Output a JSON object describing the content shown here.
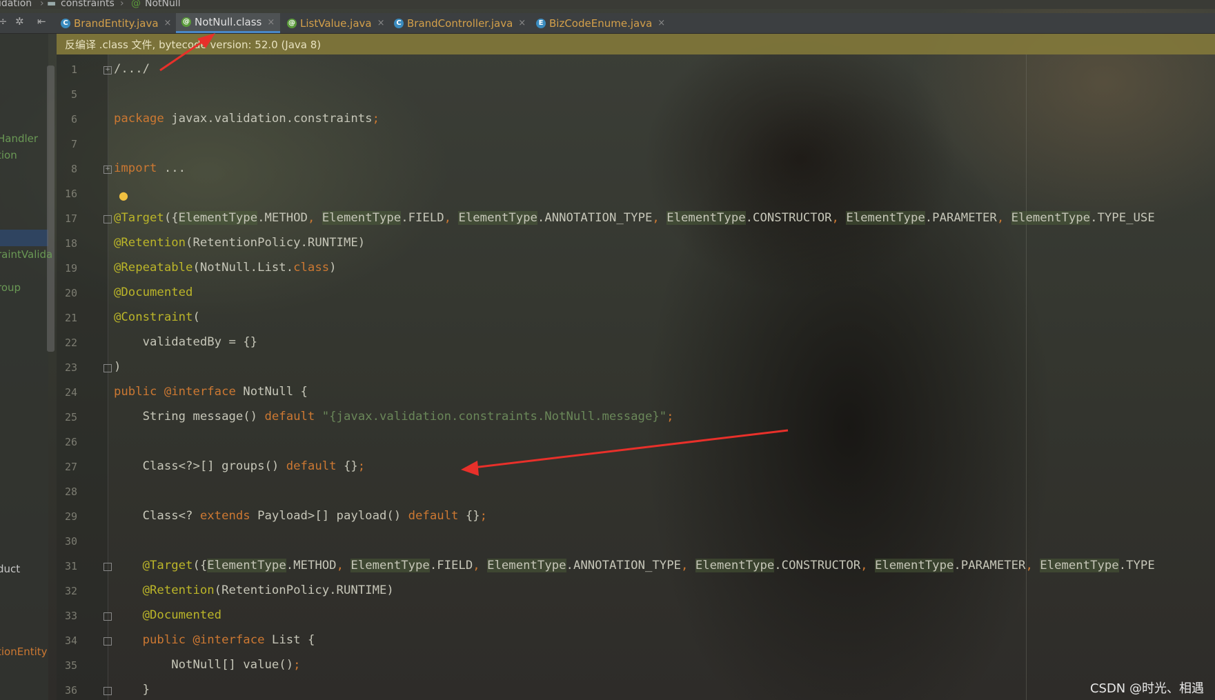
{
  "breadcrumb": [
    "idation",
    "constraints",
    "NotNull"
  ],
  "tabs": [
    {
      "label": "BrandEntity.java",
      "icon": "class-icon",
      "color": "#3a8bbf"
    },
    {
      "label": "NotNull.class",
      "icon": "annotation-icon",
      "color": "#5a9a3a",
      "active": true
    },
    {
      "label": "ListValue.java",
      "icon": "annotation-icon",
      "color": "#5a9a3a"
    },
    {
      "label": "BrandController.java",
      "icon": "class-icon",
      "color": "#3a8bbf"
    },
    {
      "label": "BizCodeEnume.java",
      "icon": "enum-icon",
      "color": "#3a8bbf"
    }
  ],
  "notice": "反编译 .class 文件, bytecode version: 52.0 (Java 8)",
  "sidebar": [
    {
      "label": "Handler"
    },
    {
      "label": "tion"
    },
    {
      "label": "raintValida"
    },
    {
      "label": "roup"
    },
    {
      "label": "duct"
    },
    {
      "label": "tionEntity"
    }
  ],
  "lines": [
    {
      "num": "1",
      "text": "/.../"
    },
    {
      "num": "5",
      "text": ""
    },
    {
      "num": "6",
      "text": "package javax.validation.constraints;"
    },
    {
      "num": "7",
      "text": ""
    },
    {
      "num": "8",
      "text": "import ..."
    },
    {
      "num": "16",
      "text": ""
    },
    {
      "num": "17",
      "text": "@Target({ElementType.METHOD, ElementType.FIELD, ElementType.ANNOTATION_TYPE, ElementType.CONSTRUCTOR, ElementType.PARAMETER, ElementType.TYPE_USE"
    },
    {
      "num": "18",
      "text": "@Retention(RetentionPolicy.RUNTIME)"
    },
    {
      "num": "19",
      "text": "@Repeatable(NotNull.List.class)"
    },
    {
      "num": "20",
      "text": "@Documented"
    },
    {
      "num": "21",
      "text": "@Constraint("
    },
    {
      "num": "22",
      "text": "    validatedBy = {}"
    },
    {
      "num": "23",
      "text": ")"
    },
    {
      "num": "24",
      "text": "public @interface NotNull {"
    },
    {
      "num": "25",
      "text": "    String message() default \"{javax.validation.constraints.NotNull.message}\";"
    },
    {
      "num": "26",
      "text": ""
    },
    {
      "num": "27",
      "text": "    Class<?>[] groups() default {};"
    },
    {
      "num": "28",
      "text": ""
    },
    {
      "num": "29",
      "text": "    Class<? extends Payload>[] payload() default {};"
    },
    {
      "num": "30",
      "text": ""
    },
    {
      "num": "31",
      "text": "    @Target({ElementType.METHOD, ElementType.FIELD, ElementType.ANNOTATION_TYPE, ElementType.CONSTRUCTOR, ElementType.PARAMETER, ElementType.TYPE"
    },
    {
      "num": "32",
      "text": "    @Retention(RetentionPolicy.RUNTIME)"
    },
    {
      "num": "33",
      "text": "    @Documented"
    },
    {
      "num": "34",
      "text": "    public @interface List {"
    },
    {
      "num": "35",
      "text": "        NotNull[] value();"
    },
    {
      "num": "36",
      "text": "    }"
    }
  ],
  "watermark": "CSDN @时光、相遇",
  "colors": {
    "keyword": "#cc7832",
    "annotation": "#bbb529",
    "string": "#6a8759",
    "arrow": "#e8302a",
    "notice_bg": "#847a3a"
  }
}
